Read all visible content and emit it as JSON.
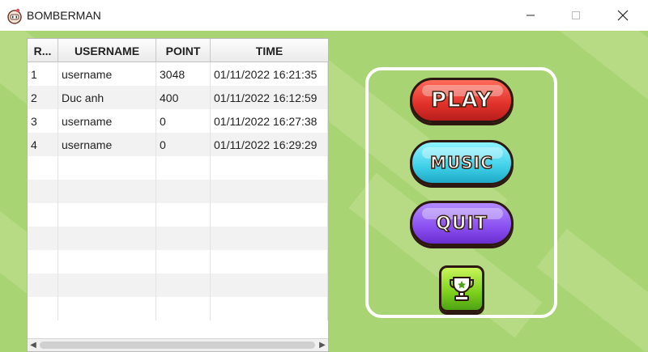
{
  "window": {
    "title": "BOMBERMAN",
    "app_icon": "bomberman-icon",
    "controls": [
      "minimize-icon",
      "maximize-icon",
      "close-icon"
    ]
  },
  "leaderboard": {
    "columns": [
      "R...",
      "USERNAME",
      "POINT",
      "TIME"
    ],
    "rows": [
      {
        "rank": "1",
        "username": "username",
        "point": "3048",
        "time": "01/11/2022 16:21:35"
      },
      {
        "rank": "2",
        "username": "Duc anh",
        "point": "400",
        "time": "01/11/2022 16:12:59"
      },
      {
        "rank": "3",
        "username": "username",
        "point": "0",
        "time": "01/11/2022 16:27:38"
      },
      {
        "rank": "4",
        "username": "username",
        "point": "0",
        "time": "01/11/2022 16:29:29"
      }
    ]
  },
  "menu": {
    "play_label": "PLAY",
    "music_label": "MUSIC",
    "quit_label": "QUIT",
    "trophy_icon": "trophy-icon"
  },
  "colors": {
    "background": "#a9d474",
    "play": "#e0312a",
    "music": "#3fd0e8",
    "quit": "#8a4ff0",
    "trophy": "#7bcf1a"
  }
}
